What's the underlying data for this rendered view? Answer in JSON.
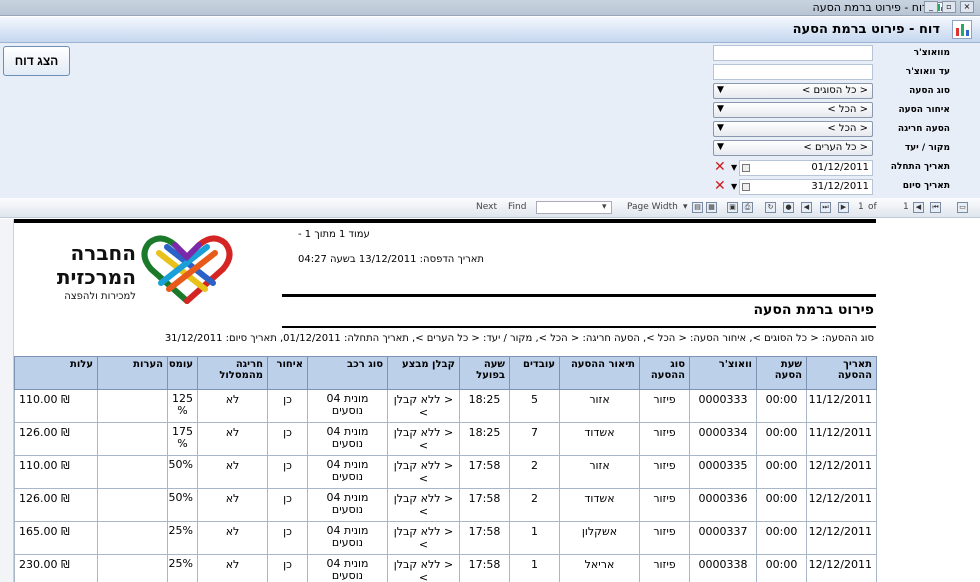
{
  "window": {
    "title": "דוח - פירוט ברמת הסעה",
    "controls": [
      "_",
      "▫",
      "×"
    ]
  },
  "header": {
    "title": "דוח - פירוט ברמת הסעה"
  },
  "actions": {
    "show_report": "הצג דוח"
  },
  "params": {
    "from_voucher": {
      "label": "מוואוצ'ר",
      "value": ""
    },
    "to_voucher": {
      "label": "עד וואוצ'ר",
      "value": ""
    },
    "trip_type": {
      "label": "סוג הסעה",
      "value": "< כל הסוגים >"
    },
    "late_trip": {
      "label": "איחור הסעה",
      "value": "< הכל >"
    },
    "exception_trip": {
      "label": "הסעה חריגה",
      "value": "< הכל >"
    },
    "source_dest": {
      "label": "מקור / יעד",
      "value": "< כל הערים >"
    },
    "start_date": {
      "label": "תאריך התחלה",
      "value": "01/12/2011"
    },
    "end_date": {
      "label": "תאריך סיום",
      "value": "31/12/2011"
    }
  },
  "toolbar": {
    "next": "Next",
    "find": "Find",
    "zoom": "Page Width",
    "page_num": "1",
    "of": "of",
    "total": "1"
  },
  "report": {
    "page_info": "עמוד 1 מתוך 1 -",
    "printed": "תאריך הדפסה: 13/12/2011 בשעה 04:27",
    "title": "פירוט ברמת הסעה",
    "criteria": "סוג ההסעה: < כל הסוגים >, איחור הסעה: < הכל >, הסעה חריגה: < הכל >, מקור / יעד: < כל הערים >, תאריך התחלה: 01/12/2011, תאריך סיום: 31/12/2011",
    "logo": {
      "line1": "החברה",
      "line2": "המרכזית",
      "line3": "למכירות ולהפצה"
    },
    "columns": [
      "תאריך ההסעה",
      "שעת הסעה",
      "וואוצ'ר",
      "סוג ההסעה",
      "תיאור ההסעה",
      "עובדים",
      "שעה בפועל",
      "קבלן מבצע",
      "סוג רכב",
      "איחור",
      "חריגה מהמסלול",
      "עומס",
      "הערות",
      "עלות"
    ],
    "rows": [
      {
        "date": "11/12/2011",
        "time": "00:00",
        "voucher": "0000333",
        "type": "פיזור",
        "desc": "אזור",
        "workers": "5",
        "actual": "18:25",
        "contractor": "< ללא קבלן >",
        "vehicle": "מונית 04 נוסעים",
        "late": "כן",
        "deviation": "לא",
        "load": "125 %",
        "notes": "",
        "cost": "110.00 ₪"
      },
      {
        "date": "11/12/2011",
        "time": "00:00",
        "voucher": "0000334",
        "type": "פיזור",
        "desc": "אשדוד",
        "workers": "7",
        "actual": "18:25",
        "contractor": "< ללא קבלן >",
        "vehicle": "מונית 04 נוסעים",
        "late": "כן",
        "deviation": "לא",
        "load": "175 %",
        "notes": "",
        "cost": "126.00 ₪"
      },
      {
        "date": "12/12/2011",
        "time": "00:00",
        "voucher": "0000335",
        "type": "פיזור",
        "desc": "אזור",
        "workers": "2",
        "actual": "17:58",
        "contractor": "< ללא קבלן >",
        "vehicle": "מונית 04 נוסעים",
        "late": "כן",
        "deviation": "לא",
        "load": "50%",
        "notes": "",
        "cost": "110.00 ₪"
      },
      {
        "date": "12/12/2011",
        "time": "00:00",
        "voucher": "0000336",
        "type": "פיזור",
        "desc": "אשדוד",
        "workers": "2",
        "actual": "17:58",
        "contractor": "< ללא קבלן >",
        "vehicle": "מונית 04 נוסעים",
        "late": "כן",
        "deviation": "לא",
        "load": "50%",
        "notes": "",
        "cost": "126.00 ₪"
      },
      {
        "date": "12/12/2011",
        "time": "00:00",
        "voucher": "0000337",
        "type": "פיזור",
        "desc": "אשקלון",
        "workers": "1",
        "actual": "17:58",
        "contractor": "< ללא קבלן >",
        "vehicle": "מונית 04 נוסעים",
        "late": "כן",
        "deviation": "לא",
        "load": "25%",
        "notes": "",
        "cost": "165.00 ₪"
      },
      {
        "date": "12/12/2011",
        "time": "00:00",
        "voucher": "0000338",
        "type": "פיזור",
        "desc": "אריאל",
        "workers": "1",
        "actual": "17:58",
        "contractor": "< ללא קבלן >",
        "vehicle": "מונית 04 נוסעים",
        "late": "כן",
        "deviation": "לא",
        "load": "25%",
        "notes": "",
        "cost": "230.00 ₪"
      }
    ]
  },
  "colors": {
    "header_bg": "#c5d7ef",
    "table_header": "#bdd0ea",
    "error_x": "#c81e1e"
  }
}
